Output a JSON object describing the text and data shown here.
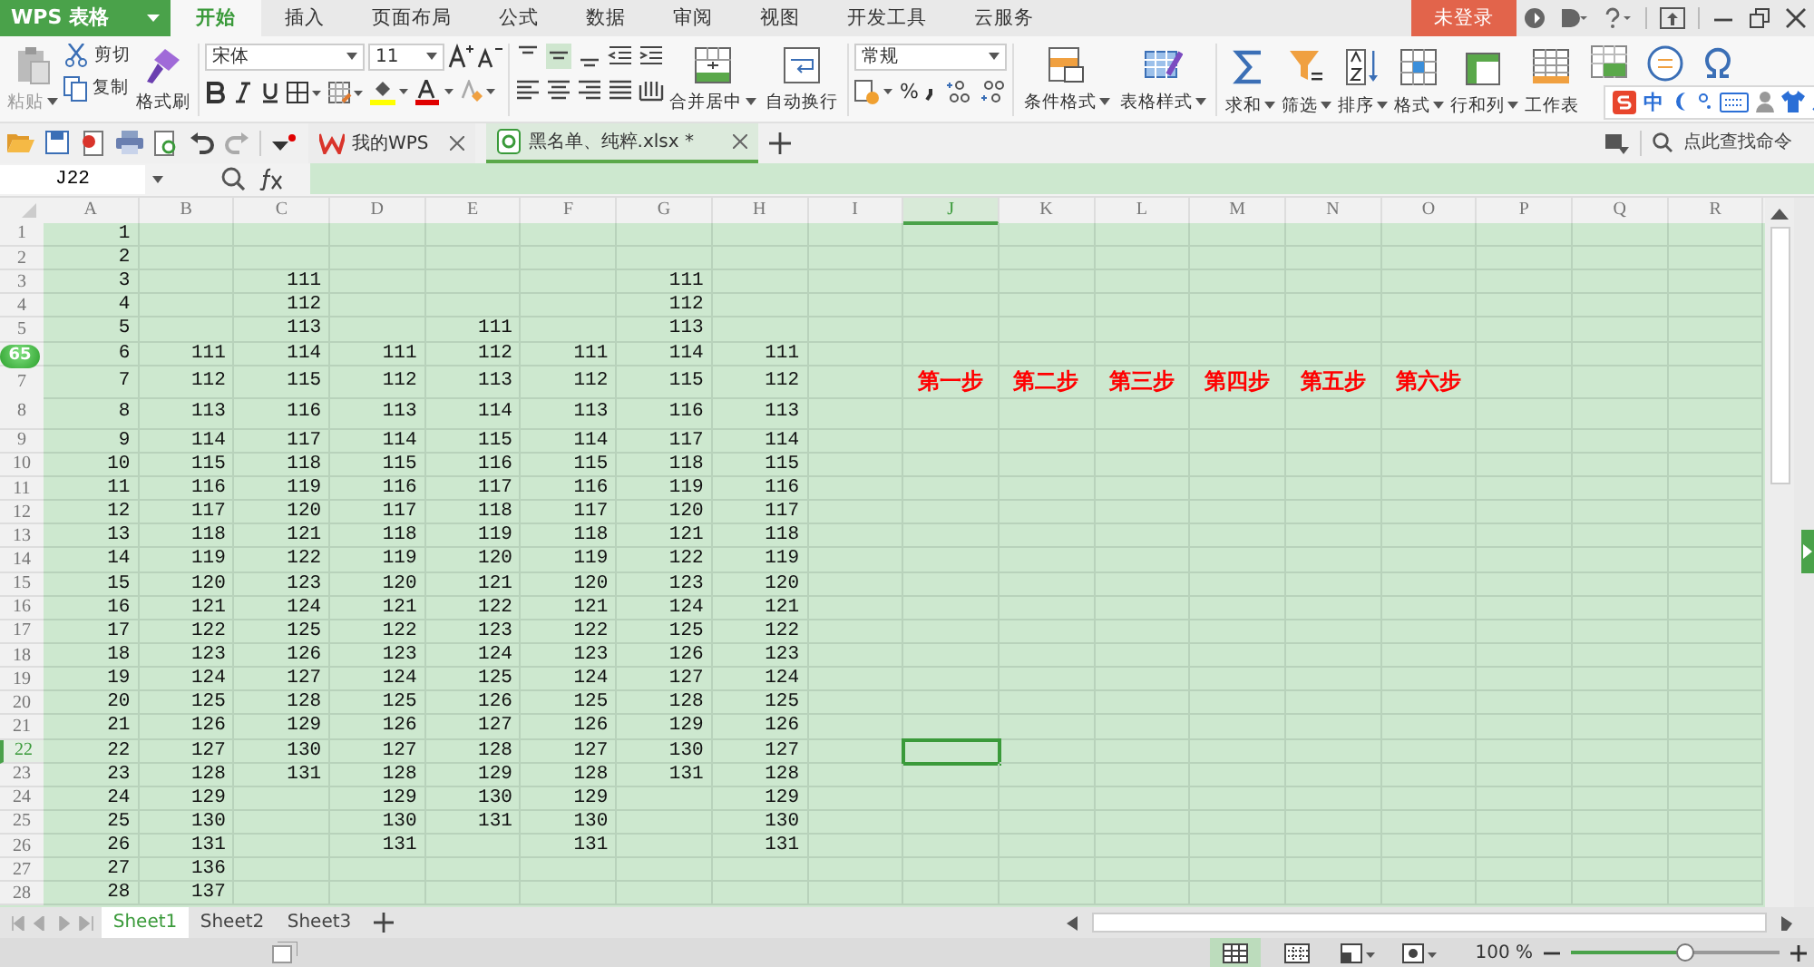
{
  "app_menu": {
    "label": "WPS 表格"
  },
  "ribbon_tabs": [
    {
      "label": "开始",
      "selected": true
    },
    {
      "label": "插入",
      "selected": false
    },
    {
      "label": "页面布局",
      "selected": false
    },
    {
      "label": "公式",
      "selected": false
    },
    {
      "label": "数据",
      "selected": false
    },
    {
      "label": "审阅",
      "selected": false
    },
    {
      "label": "视图",
      "selected": false
    },
    {
      "label": "开发工具",
      "selected": false
    },
    {
      "label": "云服务",
      "selected": false
    }
  ],
  "account": {
    "label": "未登录"
  },
  "clipboard": {
    "paste": {
      "label": "粘贴",
      "disabled": true
    },
    "cut": "剪切",
    "copy": "复制",
    "format_painter": "格式刷"
  },
  "font": {
    "name": "宋体",
    "size": "11"
  },
  "alignment": {
    "merge": "合并居中",
    "wrap": "自动换行"
  },
  "number": {
    "format": "常规",
    "percent": "%"
  },
  "styles": [
    "条件格式",
    "表格样式"
  ],
  "tools": [
    "求和",
    "筛选",
    "排序",
    "格式",
    "行和列",
    "工作表"
  ],
  "ime_bar": {
    "mode": "中"
  },
  "doc_tabs": [
    {
      "label": "我的WPS",
      "selected": false
    },
    {
      "label": "黑名单、纯粹.xlsx *",
      "selected": true
    }
  ],
  "command_search": {
    "placeholder": "点此查找命令"
  },
  "name_box": {
    "value": "J22"
  },
  "floating_badge": {
    "label": "65"
  },
  "columns": [
    {
      "label": "A",
      "selected": false
    },
    {
      "label": "B",
      "selected": false
    },
    {
      "label": "C",
      "selected": false
    },
    {
      "label": "D",
      "selected": false
    },
    {
      "label": "E",
      "selected": false
    },
    {
      "label": "F",
      "selected": false
    },
    {
      "label": "G",
      "selected": false
    },
    {
      "label": "H",
      "selected": false
    },
    {
      "label": "I",
      "selected": false
    },
    {
      "label": "J",
      "selected": true
    },
    {
      "label": "K",
      "selected": false
    },
    {
      "label": "L",
      "selected": false
    },
    {
      "label": "M",
      "selected": false
    },
    {
      "label": "N",
      "selected": false
    },
    {
      "label": "O",
      "selected": false
    },
    {
      "label": "P",
      "selected": false
    },
    {
      "label": "Q",
      "selected": false
    },
    {
      "label": "R",
      "selected": false
    }
  ],
  "rows": [
    {
      "number": "1",
      "selected": false,
      "cells": [
        "1"
      ]
    },
    {
      "number": "2",
      "selected": false,
      "cells": [
        "2"
      ]
    },
    {
      "number": "3",
      "selected": false,
      "cells": [
        "3",
        null,
        "111",
        null,
        null,
        null,
        "111"
      ]
    },
    {
      "number": "4",
      "selected": false,
      "cells": [
        "4",
        null,
        "112",
        null,
        null,
        null,
        "112"
      ]
    },
    {
      "number": "5",
      "selected": false,
      "cells": [
        "5",
        null,
        "113",
        null,
        "111",
        null,
        "113"
      ]
    },
    {
      "selected": false,
      "cells": [
        "6",
        "111",
        "114",
        "111",
        "112",
        "111",
        "114",
        "111"
      ]
    },
    {
      "number": "7",
      "selected": false,
      "cells": [
        "7",
        "112",
        "115",
        "112",
        "113",
        "112",
        "115",
        "112",
        null,
        {
          "text": "第一步",
          "color": "#ff0000"
        },
        {
          "text": "第二步",
          "color": "#ff0000"
        },
        {
          "text": "第三步",
          "color": "#ff0000"
        },
        {
          "text": "第四步",
          "color": "#ff0000"
        },
        {
          "text": "第五步",
          "color": "#ff0000"
        },
        {
          "text": "第六步",
          "color": "#ff0000"
        }
      ]
    },
    {
      "number": "8",
      "selected": false,
      "cells": [
        "8",
        "113",
        "116",
        "113",
        "114",
        "113",
        "116",
        "113"
      ]
    },
    {
      "number": "9",
      "selected": false,
      "cells": [
        "9",
        "114",
        "117",
        "114",
        "115",
        "114",
        "117",
        "114"
      ]
    },
    {
      "number": "10",
      "selected": false,
      "cells": [
        "10",
        "115",
        "118",
        "115",
        "116",
        "115",
        "118",
        "115"
      ]
    },
    {
      "number": "11",
      "selected": false,
      "cells": [
        "11",
        "116",
        "119",
        "116",
        "117",
        "116",
        "119",
        "116"
      ]
    },
    {
      "number": "12",
      "selected": false,
      "cells": [
        "12",
        "117",
        "120",
        "117",
        "118",
        "117",
        "120",
        "117"
      ]
    },
    {
      "number": "13",
      "selected": false,
      "cells": [
        "13",
        "118",
        "121",
        "118",
        "119",
        "118",
        "121",
        "118"
      ]
    },
    {
      "number": "14",
      "selected": false,
      "cells": [
        "14",
        "119",
        "122",
        "119",
        "120",
        "119",
        "122",
        "119"
      ]
    },
    {
      "number": "15",
      "selected": false,
      "cells": [
        "15",
        "120",
        "123",
        "120",
        "121",
        "120",
        "123",
        "120"
      ]
    },
    {
      "number": "16",
      "selected": false,
      "cells": [
        "16",
        "121",
        "124",
        "121",
        "122",
        "121",
        "124",
        "121"
      ]
    },
    {
      "number": "17",
      "selected": false,
      "cells": [
        "17",
        "122",
        "125",
        "122",
        "123",
        "122",
        "125",
        "122"
      ]
    },
    {
      "number": "18",
      "selected": false,
      "cells": [
        "18",
        "123",
        "126",
        "123",
        "124",
        "123",
        "126",
        "123"
      ]
    },
    {
      "number": "19",
      "selected": false,
      "cells": [
        "19",
        "124",
        "127",
        "124",
        "125",
        "124",
        "127",
        "124"
      ]
    },
    {
      "number": "20",
      "selected": false,
      "cells": [
        "20",
        "125",
        "128",
        "125",
        "126",
        "125",
        "128",
        "125"
      ]
    },
    {
      "number": "21",
      "selected": false,
      "cells": [
        "21",
        "126",
        "129",
        "126",
        "127",
        "126",
        "129",
        "126"
      ]
    },
    {
      "number": "22",
      "selected": true,
      "cells": [
        "22",
        "127",
        "130",
        "127",
        "128",
        "127",
        "130",
        "127"
      ]
    },
    {
      "number": "23",
      "selected": false,
      "cells": [
        "23",
        "128",
        "131",
        "128",
        "129",
        "128",
        "131",
        "128"
      ]
    },
    {
      "number": "24",
      "selected": false,
      "cells": [
        "24",
        "129",
        null,
        "129",
        "130",
        "129",
        null,
        "129"
      ]
    },
    {
      "number": "25",
      "selected": false,
      "cells": [
        "25",
        "130",
        null,
        "130",
        "131",
        "130",
        null,
        "130"
      ]
    },
    {
      "number": "26",
      "selected": false,
      "cells": [
        "26",
        "131",
        null,
        "131",
        null,
        "131",
        null,
        "131"
      ]
    },
    {
      "number": "27",
      "selected": false,
      "cells": [
        "27",
        "136"
      ]
    },
    {
      "number": "28",
      "selected": false,
      "cells": [
        "28",
        "137"
      ]
    }
  ],
  "sheet_tabs": [
    {
      "label": "Sheet1",
      "selected": true
    },
    {
      "label": "Sheet2",
      "selected": false
    },
    {
      "label": "Sheet3",
      "selected": false
    }
  ],
  "zoom": {
    "reading": "100 %",
    "level": 0.55
  }
}
